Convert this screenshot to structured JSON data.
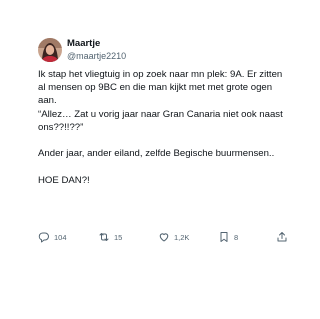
{
  "author": {
    "display_name": "Maartje",
    "handle": "@maartje2210",
    "avatar_icon": "profile-photo"
  },
  "post": {
    "lines": [
      "Ik stap het vliegtuig in op zoek naar mn plek: 9A. Er zitten al mensen op 9BC en die man kijkt met met grote ogen aan.",
      "“Allez… Zat u vorig jaar naar Gran Canaria niet ook naast ons??!!??”",
      "",
      "Ander jaar, ander eiland, zelfde Begische buurmensen..",
      "",
      "HOE DAN?!"
    ]
  },
  "actions": {
    "reply": {
      "icon": "reply-icon",
      "count": "104"
    },
    "retweet": {
      "icon": "retweet-icon",
      "count": "15"
    },
    "like": {
      "icon": "heart-icon",
      "count": "1,2K"
    },
    "bookmark": {
      "icon": "bookmark-icon",
      "count": "8"
    },
    "share": {
      "icon": "share-icon"
    }
  },
  "colors": {
    "text": "#0f1419",
    "secondary": "#536471",
    "background": "#ffffff"
  }
}
